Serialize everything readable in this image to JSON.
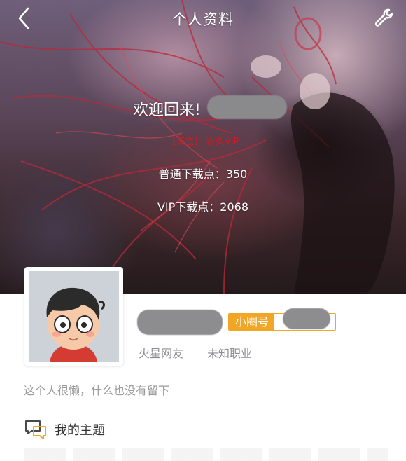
{
  "header": {
    "title": "个人资料",
    "back_icon": "chevron-left-icon",
    "settings_icon": "wrench-icon"
  },
  "hero": {
    "welcome_text": "欢迎回来!",
    "vip_badge": "【黄金】 永久VIP",
    "normal_downloads": "普通下载点：350",
    "vip_downloads": "VIP下载点：2068"
  },
  "profile": {
    "circle_badge_label": "小圈号",
    "group": "火星网友",
    "occupation": "未知职业",
    "signature": "这个人很懒，什么也没有留下"
  },
  "menu": {
    "my_topics_label": "我的主题",
    "my_topics_icon": "chat-bubbles-icon"
  },
  "colors": {
    "accent": "#f2a626",
    "vip_red": "#e0151d",
    "muted_text": "#8e8e93"
  }
}
